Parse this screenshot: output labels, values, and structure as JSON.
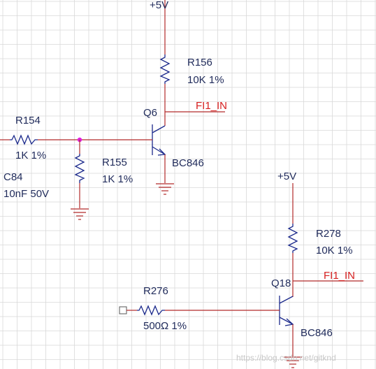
{
  "colors": {
    "grid": "#d9d9d9",
    "wire": "#b22a2a",
    "component": "#1c2a8c",
    "text": "#1f2a5a",
    "net_label": "#d62020",
    "junction": "#e020e0",
    "background": "#ffffff"
  },
  "circuit_top": {
    "supply": "+5V",
    "r156": {
      "ref": "R156",
      "value": "10K 1%"
    },
    "q6": {
      "ref": "Q6",
      "part": "BC846"
    },
    "net_out": "FI1_IN",
    "r154": {
      "ref": "R154",
      "value": "1K 1%"
    },
    "c84": {
      "ref": "C84",
      "value": "10nF 50V"
    },
    "r155": {
      "ref": "R155",
      "value": "1K 1%"
    }
  },
  "circuit_bottom": {
    "supply": "+5V",
    "r278": {
      "ref": "R278",
      "value": "10K 1%"
    },
    "q18": {
      "ref": "Q18",
      "part": "BC846"
    },
    "net_out": "FI1_IN",
    "r276": {
      "ref": "R276",
      "value": "500Ω 1%"
    }
  },
  "watermark": "https://blog.csdn.net/gitknd"
}
